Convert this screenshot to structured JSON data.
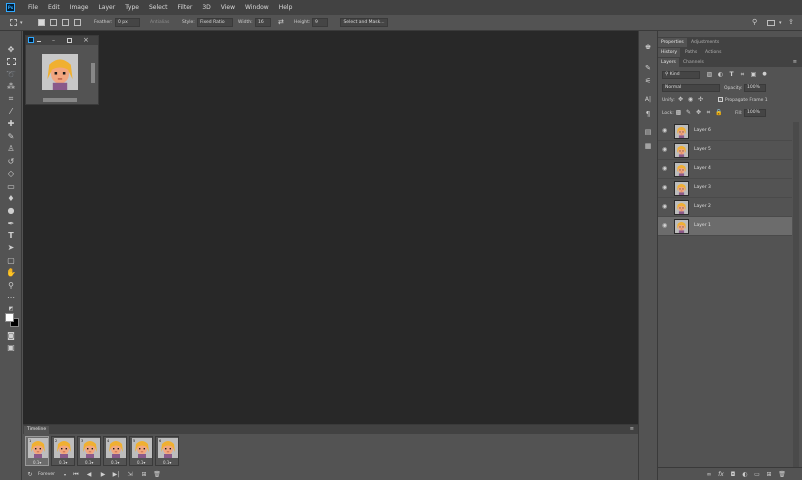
{
  "app": {
    "logo": "Ps"
  },
  "menu": [
    "File",
    "Edit",
    "Image",
    "Layer",
    "Type",
    "Select",
    "Filter",
    "3D",
    "View",
    "Window",
    "Help"
  ],
  "options": {
    "feather_label": "Feather:",
    "feather_value": "0 px",
    "antialias_label": "Antialias",
    "style_label": "Style:",
    "style_value": "Fixed Ratio",
    "width_label": "Width:",
    "width_value": "16",
    "height_label": "Height:",
    "height_value": "9",
    "select_mask": "Select and Mask..."
  },
  "panels": {
    "top_tabs": [
      "Properties",
      "Adjustments"
    ],
    "mid_tabs": [
      "History",
      "Paths",
      "Actions"
    ],
    "layer_tabs": [
      "Layers",
      "Channels"
    ],
    "kind_label": "Kind",
    "blend_mode": "Normal",
    "opacity_label": "Opacity:",
    "opacity_value": "100%",
    "unify_label": "Unify:",
    "propagate_label": "Propagate Frame 1",
    "lock_label": "Lock:",
    "fill_label": "Fill:",
    "fill_value": "100%"
  },
  "layers": [
    {
      "name": "Layer 6",
      "visible": true,
      "selected": false
    },
    {
      "name": "Layer 5",
      "visible": true,
      "selected": false
    },
    {
      "name": "Layer 4",
      "visible": true,
      "selected": false
    },
    {
      "name": "Layer 3",
      "visible": true,
      "selected": false
    },
    {
      "name": "Layer 2",
      "visible": true,
      "selected": false
    },
    {
      "name": "Layer 1",
      "visible": true,
      "selected": true
    }
  ],
  "timeline": {
    "title": "Timeline",
    "frames": [
      {
        "num": "1",
        "duration": "0.1",
        "selected": true
      },
      {
        "num": "2",
        "duration": "0.1",
        "selected": false
      },
      {
        "num": "3",
        "duration": "0.1",
        "selected": false
      },
      {
        "num": "4",
        "duration": "0.1",
        "selected": false
      },
      {
        "num": "5",
        "duration": "0.1",
        "selected": false
      },
      {
        "num": "6",
        "duration": "0.1",
        "selected": false
      }
    ],
    "loop": "Forever"
  },
  "colors": {
    "ui_bg": "#535353",
    "canvas_bg": "#282828",
    "header_bg": "#424242",
    "selected_row": "#6c6c6c",
    "ps_blue": "#31a8ff"
  }
}
